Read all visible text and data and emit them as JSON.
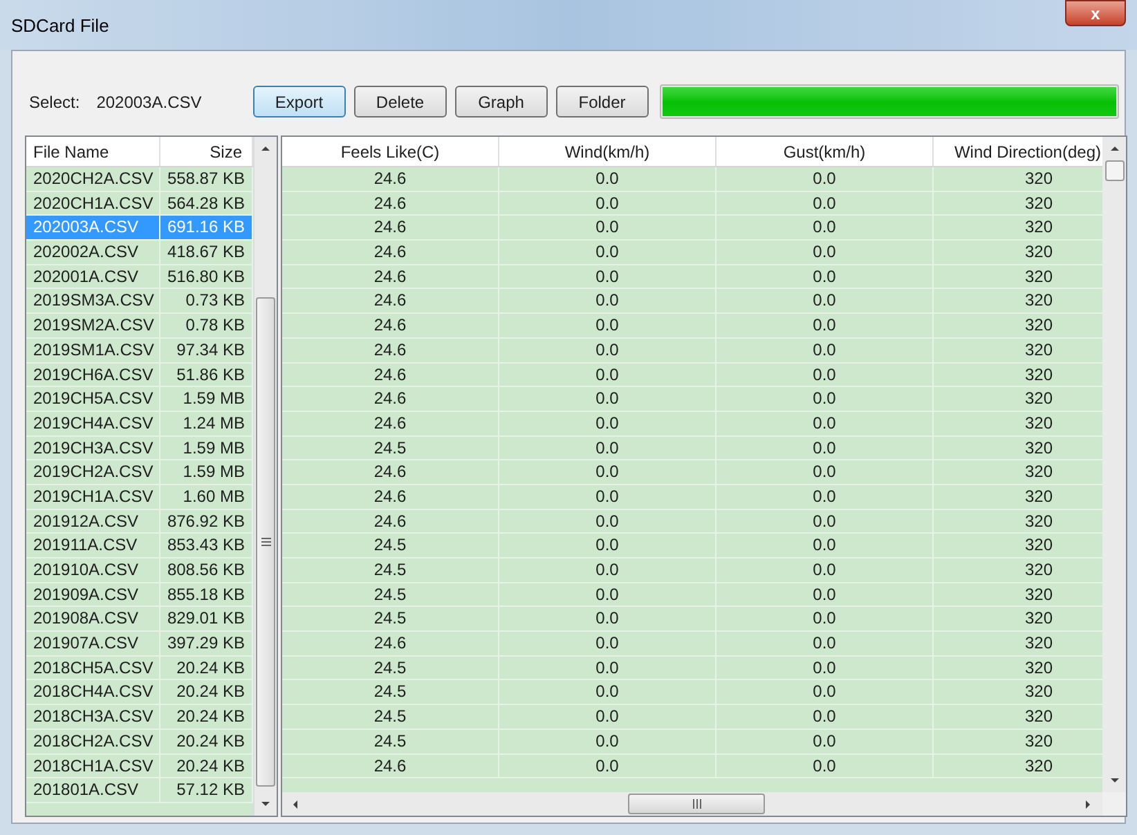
{
  "window": {
    "title": "SDCard File",
    "close": "x"
  },
  "select": {
    "label": "Select:",
    "value": "202003A.CSV"
  },
  "buttons": [
    {
      "label": "Export",
      "selected": true
    },
    {
      "label": "Delete",
      "selected": false
    },
    {
      "label": "Graph",
      "selected": false
    },
    {
      "label": "Folder",
      "selected": false
    }
  ],
  "progress": {
    "level": 1
  },
  "files": {
    "columns": [
      "File Name",
      "Size"
    ],
    "rows": [
      {
        "name": "2020CH2A.CSV",
        "size": "558.87 KB",
        "selected": false
      },
      {
        "name": "2020CH1A.CSV",
        "size": "564.28 KB",
        "selected": false
      },
      {
        "name": "202003A.CSV",
        "size": "691.16 KB",
        "selected": true
      },
      {
        "name": "202002A.CSV",
        "size": "418.67 KB",
        "selected": false
      },
      {
        "name": "202001A.CSV",
        "size": "516.80 KB",
        "selected": false
      },
      {
        "name": "2019SM3A.CSV",
        "size": "0.73 KB",
        "selected": false
      },
      {
        "name": "2019SM2A.CSV",
        "size": "0.78 KB",
        "selected": false
      },
      {
        "name": "2019SM1A.CSV",
        "size": "97.34 KB",
        "selected": false
      },
      {
        "name": "2019CH6A.CSV",
        "size": "51.86 KB",
        "selected": false
      },
      {
        "name": "2019CH5A.CSV",
        "size": "1.59 MB",
        "selected": false
      },
      {
        "name": "2019CH4A.CSV",
        "size": "1.24 MB",
        "selected": false
      },
      {
        "name": "2019CH3A.CSV",
        "size": "1.59 MB",
        "selected": false
      },
      {
        "name": "2019CH2A.CSV",
        "size": "1.59 MB",
        "selected": false
      },
      {
        "name": "2019CH1A.CSV",
        "size": "1.60 MB",
        "selected": false
      },
      {
        "name": "201912A.CSV",
        "size": "876.92 KB",
        "selected": false
      },
      {
        "name": "201911A.CSV",
        "size": "853.43 KB",
        "selected": false
      },
      {
        "name": "201910A.CSV",
        "size": "808.56 KB",
        "selected": false
      },
      {
        "name": "201909A.CSV",
        "size": "855.18 KB",
        "selected": false
      },
      {
        "name": "201908A.CSV",
        "size": "829.01 KB",
        "selected": false
      },
      {
        "name": "201907A.CSV",
        "size": "397.29 KB",
        "selected": false
      },
      {
        "name": "2018CH5A.CSV",
        "size": "20.24 KB",
        "selected": false
      },
      {
        "name": "2018CH4A.CSV",
        "size": "20.24 KB",
        "selected": false
      },
      {
        "name": "2018CH3A.CSV",
        "size": "20.24 KB",
        "selected": false
      },
      {
        "name": "2018CH2A.CSV",
        "size": "20.24 KB",
        "selected": false
      },
      {
        "name": "2018CH1A.CSV",
        "size": "20.24 KB",
        "selected": false
      },
      {
        "name": "201801A.CSV",
        "size": "57.12 KB",
        "selected": false
      }
    ]
  },
  "data": {
    "columns": [
      "Feels Like(C)",
      "Wind(km/h)",
      "Gust(km/h)",
      "Wind Direction(deg)"
    ],
    "rows": [
      [
        "24.6",
        "0.0",
        "0.0",
        "320"
      ],
      [
        "24.6",
        "0.0",
        "0.0",
        "320"
      ],
      [
        "24.6",
        "0.0",
        "0.0",
        "320"
      ],
      [
        "24.6",
        "0.0",
        "0.0",
        "320"
      ],
      [
        "24.6",
        "0.0",
        "0.0",
        "320"
      ],
      [
        "24.6",
        "0.0",
        "0.0",
        "320"
      ],
      [
        "24.6",
        "0.0",
        "0.0",
        "320"
      ],
      [
        "24.6",
        "0.0",
        "0.0",
        "320"
      ],
      [
        "24.6",
        "0.0",
        "0.0",
        "320"
      ],
      [
        "24.6",
        "0.0",
        "0.0",
        "320"
      ],
      [
        "24.6",
        "0.0",
        "0.0",
        "320"
      ],
      [
        "24.5",
        "0.0",
        "0.0",
        "320"
      ],
      [
        "24.6",
        "0.0",
        "0.0",
        "320"
      ],
      [
        "24.6",
        "0.0",
        "0.0",
        "320"
      ],
      [
        "24.6",
        "0.0",
        "0.0",
        "320"
      ],
      [
        "24.5",
        "0.0",
        "0.0",
        "320"
      ],
      [
        "24.5",
        "0.0",
        "0.0",
        "320"
      ],
      [
        "24.5",
        "0.0",
        "0.0",
        "320"
      ],
      [
        "24.5",
        "0.0",
        "0.0",
        "320"
      ],
      [
        "24.6",
        "0.0",
        "0.0",
        "320"
      ],
      [
        "24.5",
        "0.0",
        "0.0",
        "320"
      ],
      [
        "24.5",
        "0.0",
        "0.0",
        "320"
      ],
      [
        "24.5",
        "0.0",
        "0.0",
        "320"
      ],
      [
        "24.5",
        "0.0",
        "0.0",
        "320"
      ],
      [
        "24.6",
        "0.0",
        "0.0",
        "320"
      ]
    ]
  }
}
